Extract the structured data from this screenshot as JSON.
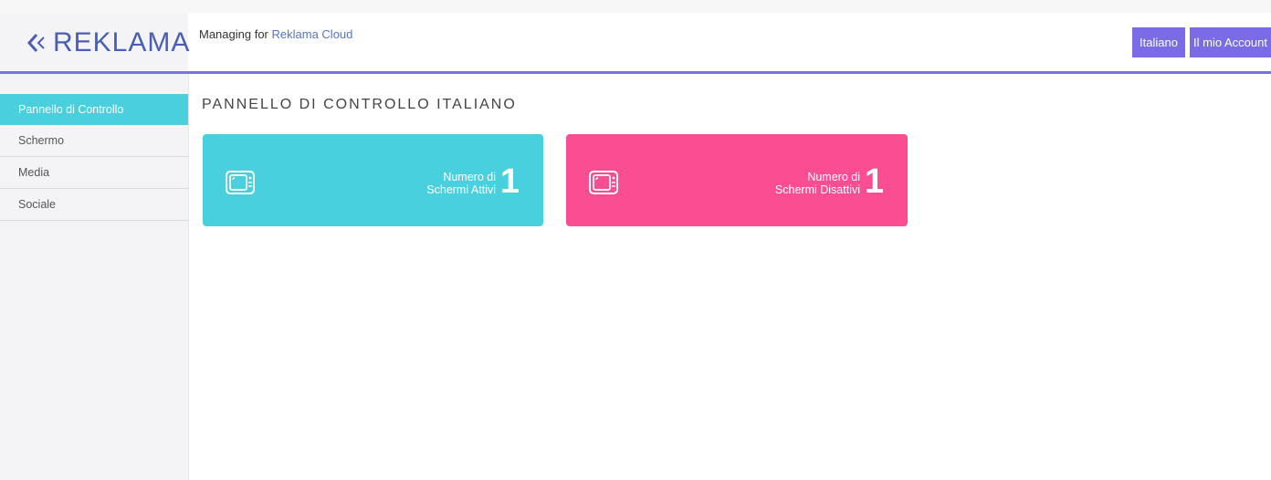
{
  "header": {
    "logo_text": "REKLAMA",
    "managing_prefix": "Managing for",
    "organization": "Reklama Cloud",
    "language_button": "Italiano",
    "account_button": "Il mio Account",
    "accent_color": "#7b73dd"
  },
  "sidebar": {
    "items": [
      {
        "label": "Pannello di Controllo",
        "active": true
      },
      {
        "label": "Schermo",
        "active": false
      },
      {
        "label": "Media",
        "active": false
      },
      {
        "label": "Sociale",
        "active": false
      }
    ]
  },
  "main": {
    "title": "PANNELLO DI CONTROLLO ITALIANO",
    "cards": [
      {
        "label_line1": "Numero di",
        "label_line2": "Schermi Attivi",
        "value": "1",
        "icon": "tv-icon",
        "color": "#48d0de"
      },
      {
        "label_line1": "Numero di",
        "label_line2": "Schermi Disattivi",
        "value": "1",
        "icon": "tv-icon",
        "color": "#fb4d91"
      }
    ]
  }
}
